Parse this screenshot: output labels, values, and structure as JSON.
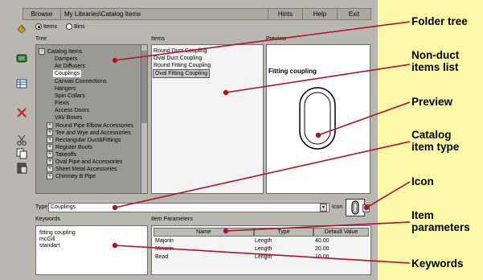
{
  "toolbar": {
    "browse": "Browse",
    "path": "My Libraries\\Catalog Items",
    "hints": "Hints",
    "help": "Help",
    "exit": "Exit"
  },
  "mode": {
    "items": "Items",
    "bins": "Bins",
    "selected": "Items"
  },
  "labels": {
    "tree": "Tree",
    "items": "Items",
    "preview": "Preview",
    "type": "Type",
    "icon": "Icon",
    "keywords": "Keywords",
    "item_parameters": "Item Parameters"
  },
  "tree": {
    "root": "Catalog Items",
    "children": [
      "Dampers",
      "Air Diffusers",
      "Couplings",
      "Canvas Connections",
      "Hangers",
      "Spin Collars",
      "Flexis",
      "Access Doors",
      "VAV Boxes"
    ],
    "selected": "Couplings",
    "groups": [
      "Round Pipe Elbow Accessories",
      "Tee and Wye and Accessories",
      "Rectangular Duct&Fittings",
      "Register Boots",
      "Takeoffs",
      "Oval Pipe and Accessories",
      "Sheet Metal Accessories",
      "Chimney B Pipe"
    ]
  },
  "items": {
    "list": [
      "Round Duct Coupling",
      "Oval Duct Coupling",
      "Round Fitting Coupling",
      "Oval Fitting Coupling"
    ],
    "selected": "Oval Fitting Coupling"
  },
  "preview": {
    "title": "Fitting coupling"
  },
  "type_field": {
    "value": "Couplings"
  },
  "keywords": [
    "fitting coupling",
    "mcGill",
    "standart"
  ],
  "parameters": {
    "columns": [
      "Name",
      "Type",
      "Default Value"
    ],
    "rows": [
      [
        "Majorin",
        "Length",
        "40.00"
      ],
      [
        "Minorin",
        "Length",
        "20.00"
      ],
      [
        "Bead",
        "Length",
        "10.00"
      ]
    ]
  },
  "callouts": {
    "folder_tree": "Folder tree",
    "non_duct": "Non-duct items list",
    "preview": "Preview",
    "catalog_type": "Catalog item type",
    "icon": "Icon",
    "item_params": "Item parameters",
    "keywords": "Keywords"
  },
  "colors": {
    "callout_bg": "#fbf9a8",
    "arrow": "#b0122b",
    "window_bg": "#b8b8b0"
  }
}
